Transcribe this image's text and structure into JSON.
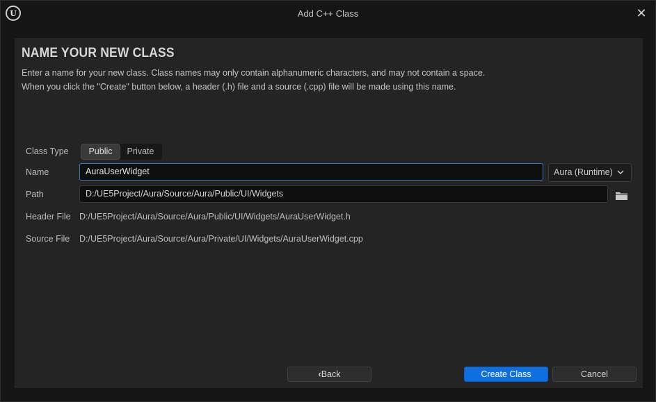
{
  "window": {
    "title": "Add C++ Class",
    "logo_text": "U",
    "close_glyph": "✕"
  },
  "page": {
    "heading": "NAME YOUR NEW CLASS",
    "desc_line1": "Enter a name for your new class. Class names may only contain alphanumeric characters, and may not contain a space.",
    "desc_line2": "When you click the \"Create\" button below, a header (.h) file and a source (.cpp) file will be made using this name."
  },
  "form": {
    "class_type_label": "Class Type",
    "class_type_options": [
      "Public",
      "Private"
    ],
    "class_type_selected": "Public",
    "name_label": "Name",
    "name_value": "AuraUserWidget",
    "module": "Aura (Runtime)",
    "path_label": "Path",
    "path_value": "D:/UE5Project/Aura/Source/Aura/Public/UI/Widgets",
    "header_label": "Header File",
    "header_value": "D:/UE5Project/Aura/Source/Aura/Public/UI/Widgets/AuraUserWidget.h",
    "source_label": "Source File",
    "source_value": "D:/UE5Project/Aura/Source/Aura/Private/UI/Widgets/AuraUserWidget.cpp"
  },
  "footer": {
    "back_label": "Back",
    "back_icon": "‹",
    "create_label": "Create Class",
    "cancel_label": "Cancel"
  },
  "icons": {
    "logo": "unreal-logo-icon",
    "close": "close-icon",
    "chevron": "chevron-down-icon",
    "folder": "folder-icon",
    "back": "chevron-left-icon"
  },
  "colors": {
    "primary_button": "#0f6ee0",
    "focus_border": "#3c78c8"
  }
}
